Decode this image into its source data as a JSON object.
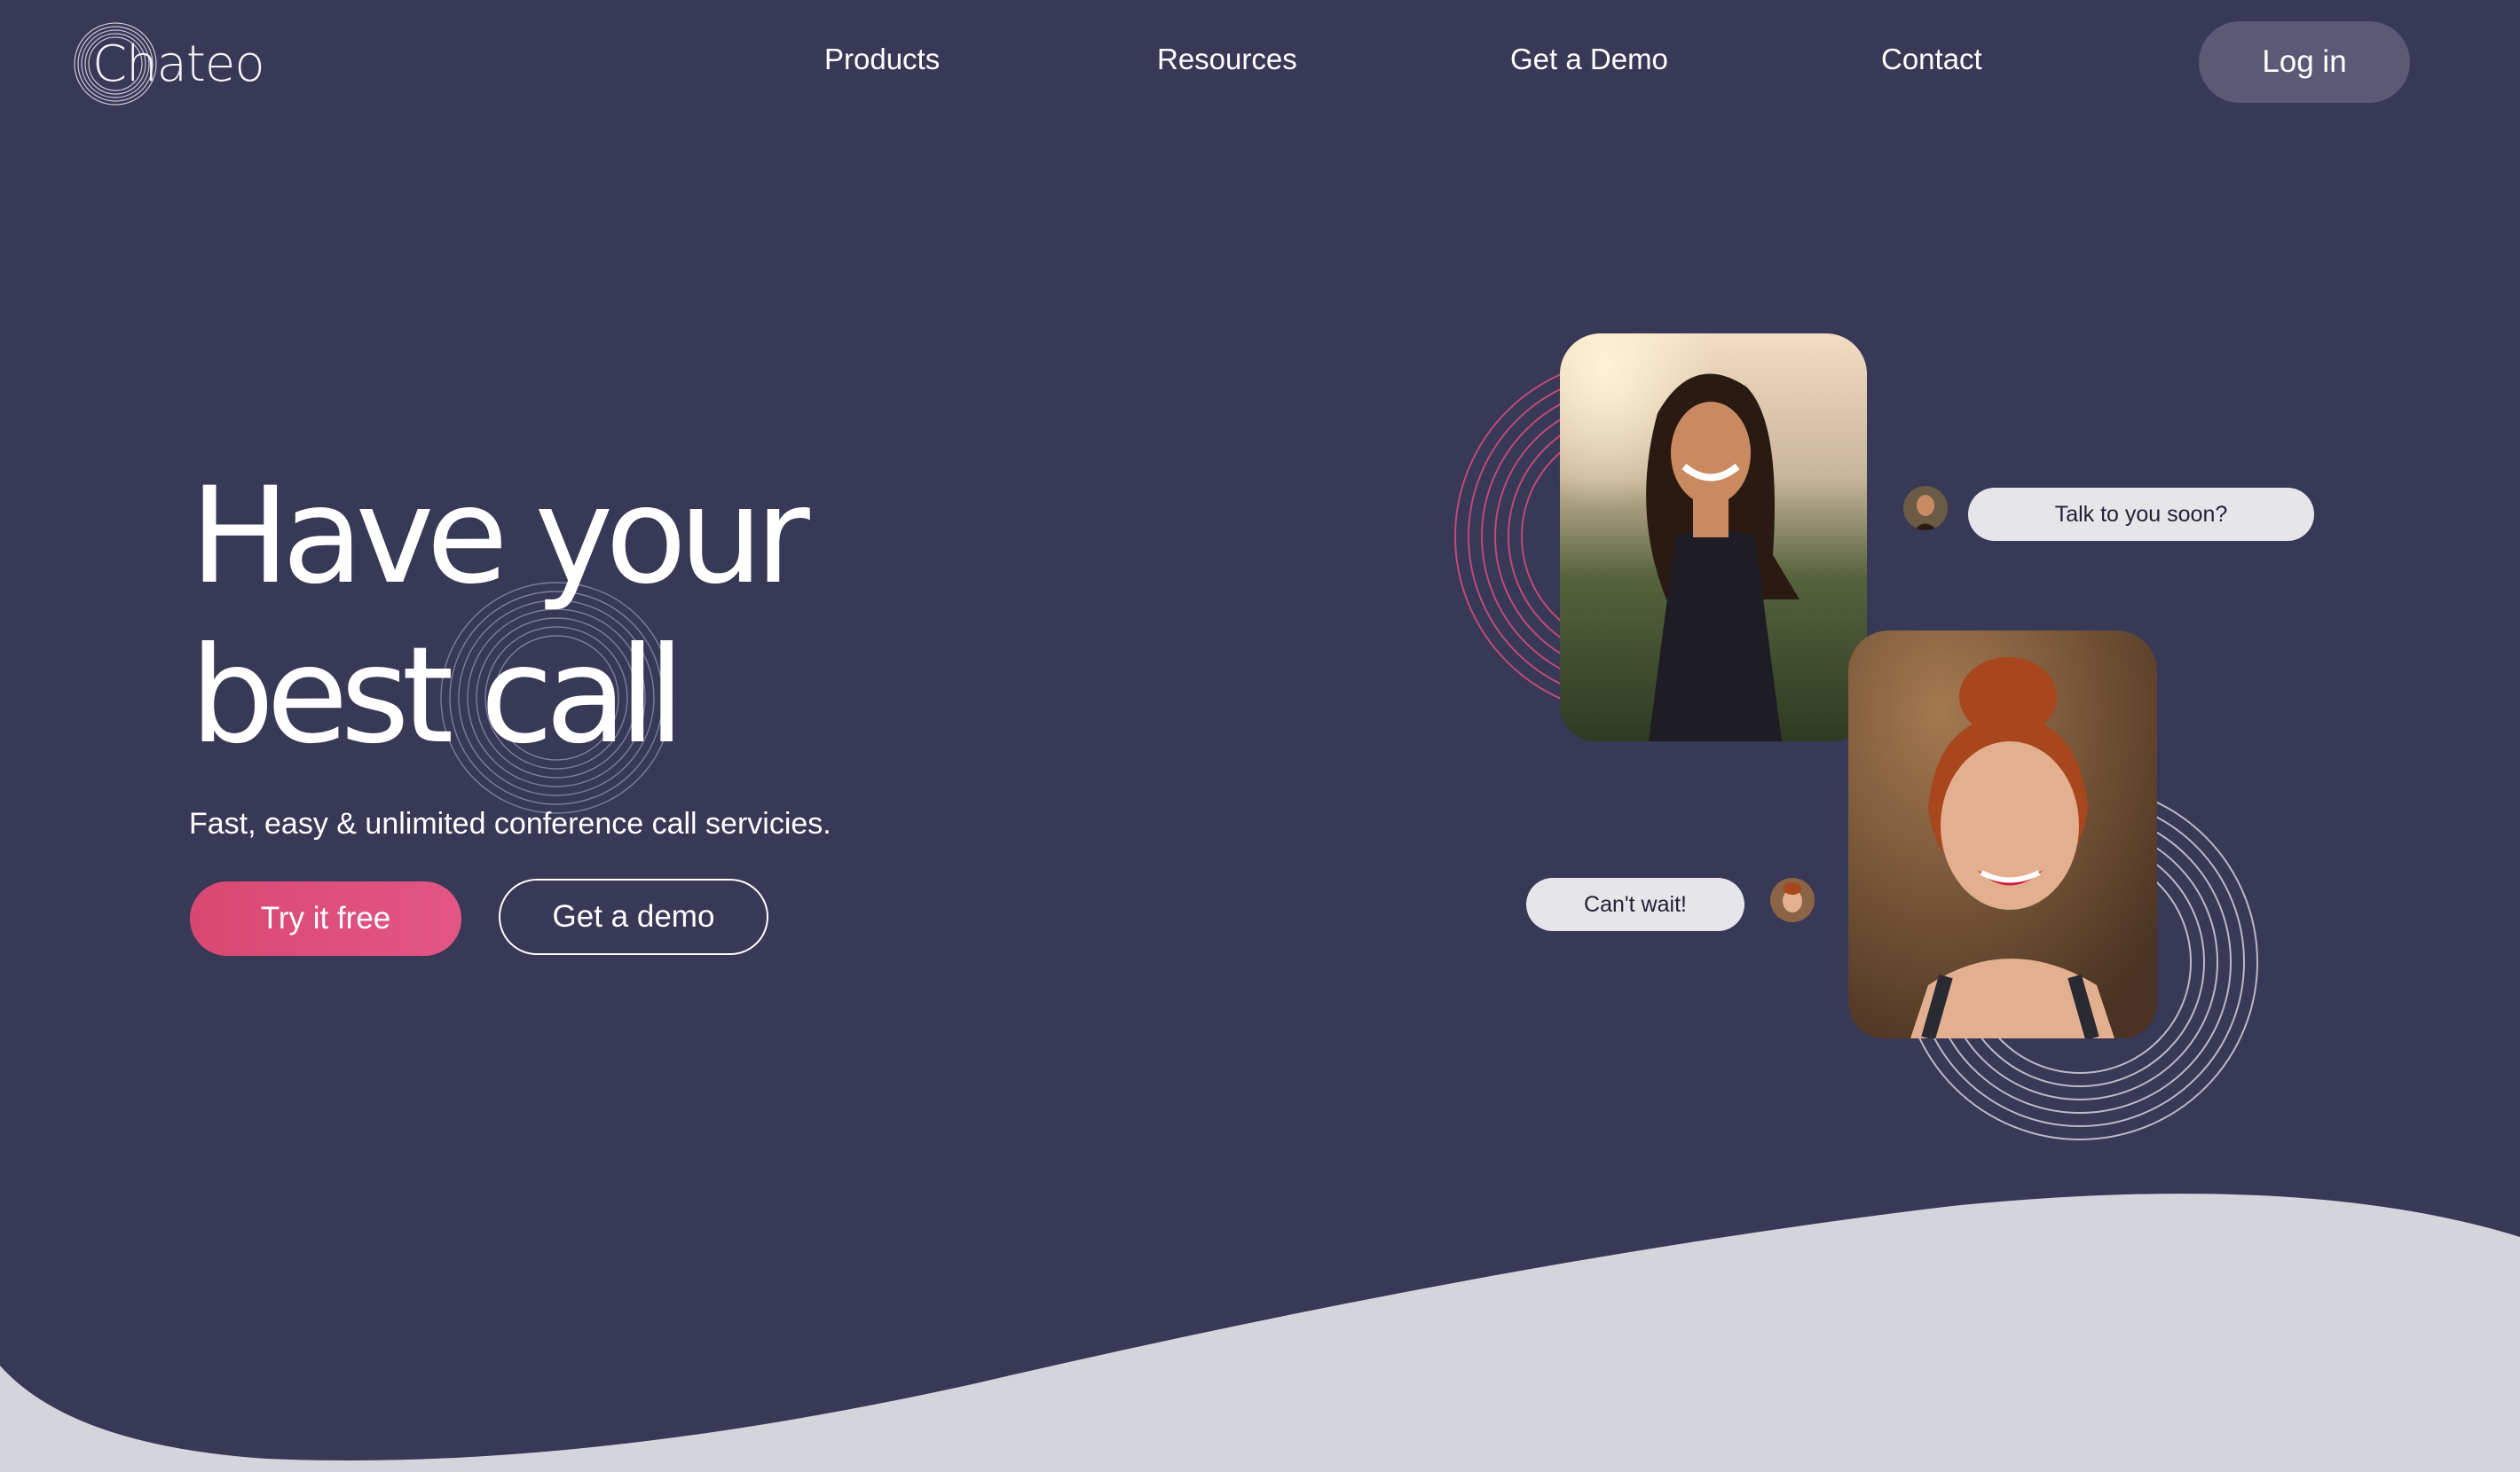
{
  "brand": {
    "name": "Chateo"
  },
  "nav": {
    "links": [
      "Products",
      "Resources",
      "Get a Demo",
      "Contact"
    ],
    "login_label": "Log in"
  },
  "hero": {
    "title_line1": "Have your",
    "title_line2": "best call",
    "subtitle": "Fast, easy & unlimited conference call servicies.",
    "primary_cta": "Try it free",
    "secondary_cta": "Get a demo"
  },
  "chat": {
    "message1": "Talk to you soon?",
    "message2": "Can't wait!"
  },
  "colors": {
    "background": "#383857",
    "accent": "#d94872",
    "wave": "#d4d4dc",
    "login_button": "#5a5a77"
  },
  "icons": [
    "logo-rings-icon",
    "concentric-rings-icon"
  ]
}
